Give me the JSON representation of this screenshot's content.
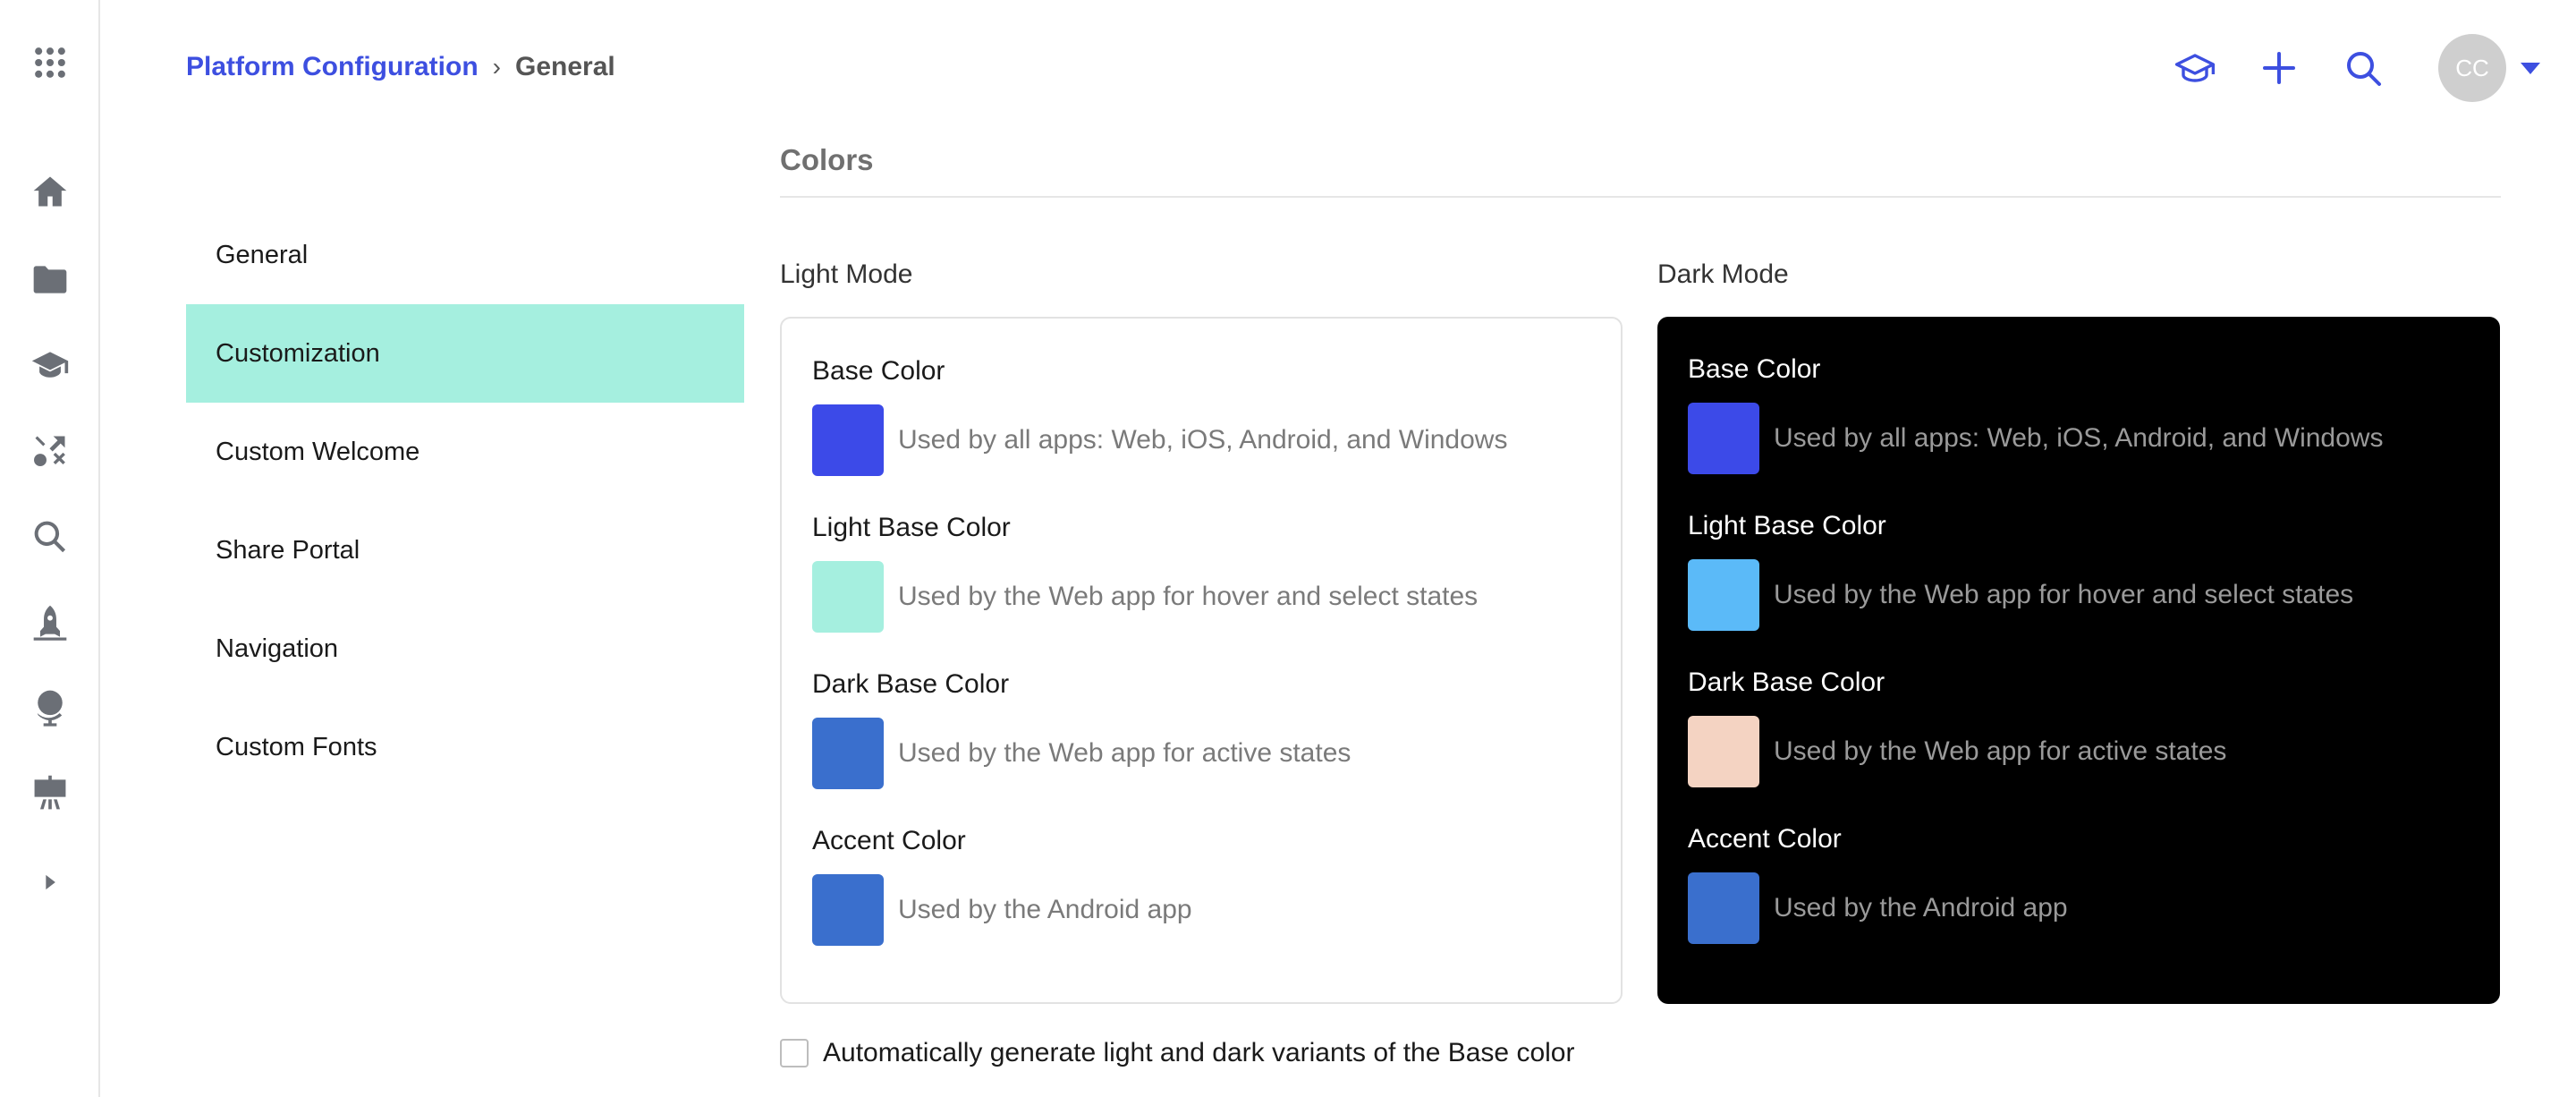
{
  "breadcrumb": {
    "parent": "Platform Configuration",
    "separator": "›",
    "current": "General"
  },
  "rail_icons": [
    "apps-grid-icon",
    "home-icon",
    "folder-icon",
    "graduation-cap-icon",
    "shuffle-icon",
    "search-icon",
    "rocket-icon",
    "globe-icon",
    "presentation-icon",
    "expand-arrow-icon"
  ],
  "header": {
    "icons": [
      "graduation-cap-icon",
      "plus-icon",
      "search-icon"
    ],
    "avatar_initials": "CC",
    "accent_color": "#3d4fe0"
  },
  "settings_nav": {
    "items": [
      {
        "label": "General",
        "active": false
      },
      {
        "label": "Customization",
        "active": true
      },
      {
        "label": "Custom Welcome",
        "active": false
      },
      {
        "label": "Share Portal",
        "active": false
      },
      {
        "label": "Navigation",
        "active": false
      },
      {
        "label": "Custom Fonts",
        "active": false
      }
    ],
    "active_color": "#a5efdf"
  },
  "colors_section": {
    "title": "Colors",
    "light_mode": {
      "label": "Light Mode",
      "items": [
        {
          "label": "Base Color",
          "description": "Used by all apps: Web, iOS, Android, and Windows",
          "color": "#3c4ae8"
        },
        {
          "label": "Light Base Color",
          "description": "Used by the Web app for hover and select states",
          "color": "#a5efdf"
        },
        {
          "label": "Dark Base Color",
          "description": "Used by the Web app for active states",
          "color": "#3a6fcd"
        },
        {
          "label": "Accent Color",
          "description": "Used by the Android app",
          "color": "#3a6fcd"
        }
      ]
    },
    "dark_mode": {
      "label": "Dark Mode",
      "items": [
        {
          "label": "Base Color",
          "description": "Used by all apps: Web, iOS, Android, and Windows",
          "color": "#3c4ae8"
        },
        {
          "label": "Light Base Color",
          "description": "Used by the Web app for hover and select states",
          "color": "#5bbaf8"
        },
        {
          "label": "Dark Base Color",
          "description": "Used by the Web app for active states",
          "color": "#f4d3c2"
        },
        {
          "label": "Accent Color",
          "description": "Used by the Android app",
          "color": "#3a6fcd"
        }
      ]
    },
    "auto_generate": {
      "label": "Automatically generate light and dark variants of the Base color",
      "checked": false
    }
  }
}
